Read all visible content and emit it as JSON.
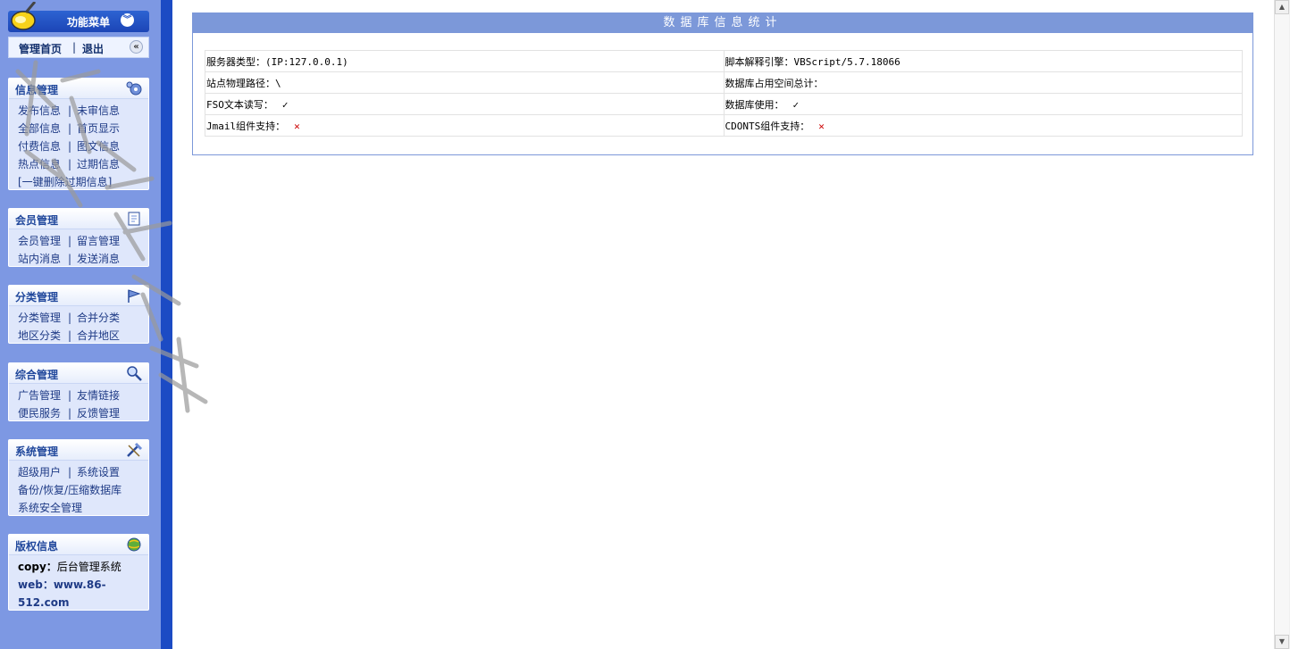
{
  "sidebar": {
    "menu_title": "功能菜单",
    "nav": {
      "home": "管理首页",
      "separator": "|",
      "exit": "退出"
    },
    "panels": [
      {
        "title": "信息管理",
        "rows": [
          [
            "发布信息",
            "未审信息"
          ],
          [
            "全部信息",
            "首页显示"
          ],
          [
            "付费信息",
            "图文信息"
          ],
          [
            "热点信息",
            "过期信息"
          ],
          [
            "[一键删除过期信息]"
          ]
        ]
      },
      {
        "title": "会员管理",
        "rows": [
          [
            "会员管理",
            "留言管理"
          ],
          [
            "站内消息",
            "发送消息"
          ]
        ]
      },
      {
        "title": "分类管理",
        "rows": [
          [
            "分类管理",
            "合并分类"
          ],
          [
            "地区分类",
            "合并地区"
          ]
        ]
      },
      {
        "title": "综合管理",
        "rows": [
          [
            "广告管理",
            "友情链接"
          ],
          [
            "便民服务",
            "反馈管理"
          ]
        ]
      },
      {
        "title": "系统管理",
        "rows": [
          [
            "超级用户",
            "系统设置"
          ],
          [
            "备份/恢复/压缩数据库"
          ],
          [
            "系统安全管理"
          ]
        ]
      },
      {
        "title": "版权信息",
        "copy_label": "copy：",
        "copy_value": "后台管理系统",
        "web_line1": "web：www.86-",
        "web_line2": "512.com"
      }
    ]
  },
  "main": {
    "title": "数据库信息统计",
    "rows": [
      {
        "left": "服务器类型：(IP:127.0.0.1)",
        "right": "脚本解释引擎：VBScript/5.7.18066"
      },
      {
        "left": "站点物理路径：\\",
        "right": "数据库占用空间总计："
      },
      {
        "left": "FSO文本读写：",
        "left_mark": "✓",
        "right": "数据库使用：",
        "right_mark": "✓"
      },
      {
        "left": "Jmail组件支持：",
        "left_mark": "✕",
        "right": "CDONTS组件支持：",
        "right_mark": "✕"
      }
    ]
  },
  "icons": {
    "logo": "broom-logo-icon",
    "menu_toggle": "double-chevron-down-icon",
    "nav_collapse": "double-chevron-left-icon",
    "panel_icons": [
      "gears-icon",
      "notepad-icon",
      "flag-icon",
      "magnifier-icon",
      "tools-icon",
      "globe-icon"
    ]
  },
  "colors": {
    "sidebar_bg": "#7d98e3",
    "sidebar_edge": "#1c4bc4",
    "header_blue": "#1c45b6",
    "title_bar": "#7c98d9",
    "cross_red": "#cc0000"
  }
}
